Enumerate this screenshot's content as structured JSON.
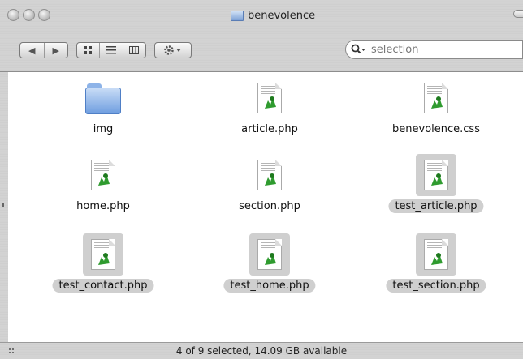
{
  "window": {
    "title": "benevolence",
    "status": "4 of 9 selected, 14.09 GB available"
  },
  "toolbar": {
    "back_forward": [
      "◀",
      "▶"
    ],
    "view_icons": [
      "icon-view",
      "list-view",
      "column-view"
    ],
    "action_icon": "gear-icon",
    "search_value": "selection"
  },
  "items": [
    {
      "name": "img",
      "kind": "folder",
      "selected": false
    },
    {
      "name": "article.php",
      "kind": "php",
      "selected": false
    },
    {
      "name": "benevolence.css",
      "kind": "css",
      "selected": false
    },
    {
      "name": "home.php",
      "kind": "php",
      "selected": false
    },
    {
      "name": "section.php",
      "kind": "php",
      "selected": false
    },
    {
      "name": "test_article.php",
      "kind": "php",
      "selected": true
    },
    {
      "name": "test_contact.php",
      "kind": "php",
      "selected": true
    },
    {
      "name": "test_home.php",
      "kind": "php",
      "selected": true
    },
    {
      "name": "test_section.php",
      "kind": "php",
      "selected": true
    }
  ]
}
